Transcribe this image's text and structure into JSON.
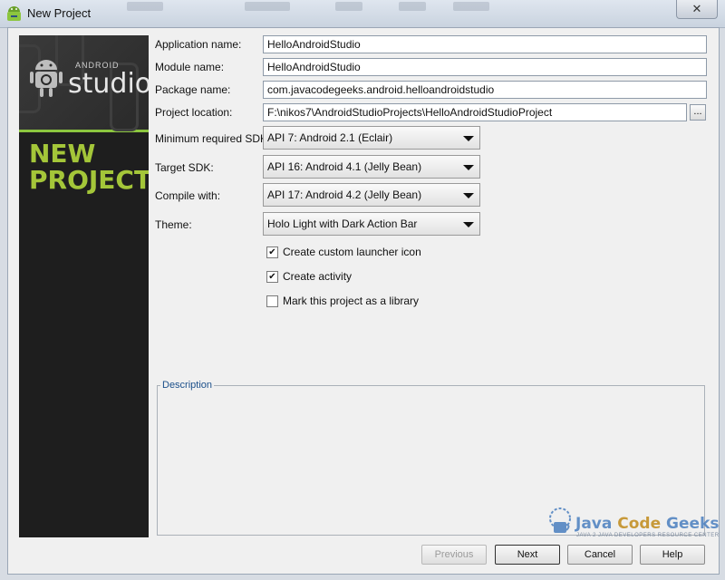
{
  "window": {
    "title": "New Project",
    "close_glyph": "✕"
  },
  "sidebar": {
    "brand_small": "ANDROID",
    "brand": "studio",
    "heading": "NEW PROJECT"
  },
  "form": {
    "app_name": {
      "label": "Application name:",
      "value": "HelloAndroidStudio"
    },
    "module_name": {
      "label": "Module name:",
      "value": "HelloAndroidStudio"
    },
    "package_name": {
      "label": "Package name:",
      "value": "com.javacodegeeks.android.helloandroidstudio"
    },
    "project_location": {
      "label": "Project location:",
      "value": "F:\\nikos7\\AndroidStudioProjects\\HelloAndroidStudioProject",
      "browse_label": "..."
    },
    "min_sdk": {
      "label": "Minimum required SDK:",
      "value": "API 7: Android 2.1 (Eclair)"
    },
    "target_sdk": {
      "label": "Target SDK:",
      "value": "API 16: Android 4.1 (Jelly Bean)"
    },
    "compile_with": {
      "label": "Compile with:",
      "value": "API 17: Android 4.2 (Jelly Bean)"
    },
    "theme": {
      "label": "Theme:",
      "value": "Holo Light with Dark Action Bar"
    },
    "checkboxes": [
      {
        "label": "Create custom launcher icon",
        "checked": true,
        "mark": "✔"
      },
      {
        "label": "Create activity",
        "checked": true,
        "mark": "✔"
      },
      {
        "label": "Mark this project as a library",
        "checked": false,
        "mark": ""
      }
    ],
    "description_legend": "Description"
  },
  "buttons": {
    "previous": "Previous",
    "next": "Next",
    "cancel": "Cancel",
    "help": "Help"
  },
  "watermark": {
    "brand1": "Java ",
    "brand2": "Code",
    "brand3": " Geeks",
    "tagline": "JAVA 2 JAVA DEVELOPERS RESOURCE CENTER"
  },
  "colors": {
    "accent_green": "#a4c639",
    "legend_blue": "#1b4f8a"
  }
}
